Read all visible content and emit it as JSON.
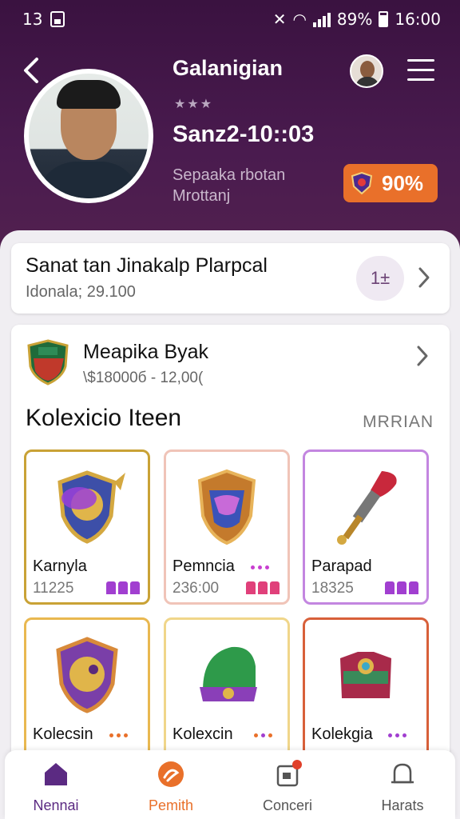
{
  "status_bar": {
    "left_text": "13",
    "battery_pct": "89%",
    "time": "16:00"
  },
  "profile": {
    "name": "Galanigian",
    "stars": "★★★",
    "date": "Sanz2-10::03",
    "subtitle_line1": "Sepaaka rbotan",
    "subtitle_line2": "Mrottanj",
    "badge_value": "90%"
  },
  "summary_card": {
    "title": "Sanat tan Jinakalp Plarpcal",
    "subtitle": "Idonala; 29.100",
    "count": "1±"
  },
  "collection_card": {
    "title": "Meapika Byak",
    "subtitle": "\\$18000б - 12,00(",
    "section_title": "Kolexicio Iteen",
    "section_link": "MRRIAN",
    "items": [
      {
        "name": "Karnyla",
        "value": "11225"
      },
      {
        "name": "Pemncia",
        "value": "236:00"
      },
      {
        "name": "Parapad",
        "value": "18325"
      },
      {
        "name": "Kolecsin",
        "value": ""
      },
      {
        "name": "Kolexcin",
        "value": ""
      },
      {
        "name": "Kolekgia",
        "value": ""
      }
    ]
  },
  "nav": {
    "items": [
      {
        "label": "Nennai",
        "color": "#5b2a82"
      },
      {
        "label": "Pemith",
        "color": "#e9702a"
      },
      {
        "label": "Conceri",
        "color": "#555555"
      },
      {
        "label": "Harats",
        "color": "#555555"
      }
    ]
  },
  "colors": {
    "header": "#3f1545",
    "accent_orange": "#e9702a",
    "accent_purple": "#a13fd0"
  }
}
